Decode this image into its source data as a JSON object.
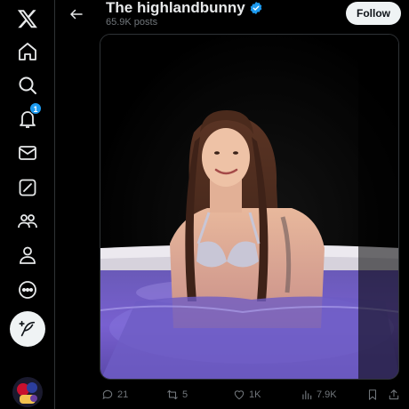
{
  "profile": {
    "name": "The highlandbunny",
    "posts_count": "65.9K posts",
    "follow_label": "Follow",
    "verified": true
  },
  "nav": {
    "items": [
      {
        "name": "x-logo-icon"
      },
      {
        "name": "home-icon"
      },
      {
        "name": "search-icon"
      },
      {
        "name": "notifications-icon",
        "badge": "1"
      },
      {
        "name": "messages-icon"
      },
      {
        "name": "grok-icon"
      },
      {
        "name": "communities-icon"
      },
      {
        "name": "profile-icon"
      },
      {
        "name": "more-icon"
      }
    ],
    "compose_icon": "feather-plus-icon"
  },
  "media": {
    "type": "photo"
  },
  "actions": {
    "replies": "21",
    "reposts": "5",
    "likes": "1K",
    "views": "7.9K"
  },
  "colors": {
    "background": "#000000",
    "accent": "#1d9bf0",
    "text_primary": "#e7e9ea",
    "text_secondary": "#71767b",
    "border": "#2f3336",
    "button_bg": "#eff3f4"
  }
}
